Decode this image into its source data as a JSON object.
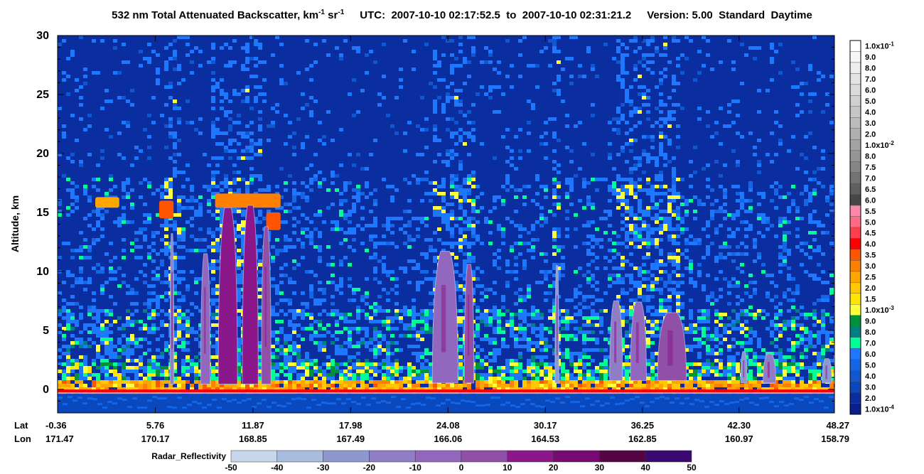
{
  "title": {
    "main": "532 nm Total Attenuated Backscatter, km",
    "sup1": "-1",
    "unit_mid": " sr",
    "sup2": "-1",
    "utc_label": "UTC:",
    "start_time": "2007-10-10 02:17:52.5",
    "to": "to",
    "end_time": "2007-10-10 02:31:21.2",
    "version": "Version: 5.00",
    "product": "Standard",
    "mode": "Daytime"
  },
  "chart_data": {
    "type": "heatmap",
    "ylabel": "Altitude, km",
    "ylim": [
      -2,
      30
    ],
    "yticks": [
      0,
      5,
      10,
      15,
      20,
      25,
      30
    ],
    "x_row_labels": [
      "Lat",
      "Lon"
    ],
    "lat": [
      "-0.36",
      "5.76",
      "11.87",
      "17.98",
      "24.08",
      "30.17",
      "36.25",
      "42.30",
      "48.27"
    ],
    "lon": [
      "171.47",
      "170.17",
      "168.85",
      "167.49",
      "166.06",
      "164.53",
      "162.85",
      "160.97",
      "158.79"
    ],
    "backscatter_colorbar": {
      "labels": [
        "1.0x10-1",
        "9.0",
        "8.0",
        "7.0",
        "6.0",
        "5.0",
        "4.0",
        "3.0",
        "2.0",
        "1.0x10-2",
        "8.0",
        "7.5",
        "7.0",
        "6.5",
        "6.0",
        "5.5",
        "5.0",
        "4.5",
        "4.0",
        "3.5",
        "3.0",
        "2.5",
        "2.0",
        "1.5",
        "1.0x10-3",
        "9.0",
        "8.0",
        "7.0",
        "6.0",
        "5.0",
        "4.0",
        "3.0",
        "2.0",
        "1.0x10-4"
      ],
      "colors": [
        "#ffffff",
        "#f6f6f6",
        "#ededed",
        "#e3e3e3",
        "#dadada",
        "#d0d0d0",
        "#c6c6c6",
        "#bcbcbc",
        "#b0b0b0",
        "#a3a3a3",
        "#959595",
        "#868686",
        "#737373",
        "#5f5f5f",
        "#474747",
        "#ff87a7",
        "#ff6b82",
        "#ff3d4e",
        "#ff0000",
        "#ff5500",
        "#ff7f00",
        "#ffa500",
        "#ffc800",
        "#ffe600",
        "#ffff3c",
        "#00913c",
        "#008080",
        "#00ff96",
        "#1e78ff",
        "#1466e6",
        "#0f58d2",
        "#0a48be",
        "#0a2da0",
        "#0a1e8c"
      ]
    },
    "radar_colorbar": {
      "title": "Radar_Reflectivity",
      "ticks": [
        "-50",
        "-40",
        "-30",
        "-20",
        "-10",
        "0",
        "10",
        "20",
        "30",
        "40",
        "50"
      ],
      "colors": [
        "#c8d6ea",
        "#a8bcde",
        "#8f97cf",
        "#8f7dc6",
        "#9168be",
        "#9150a8",
        "#8a188a",
        "#770a73",
        "#550544",
        "#3a0a70"
      ]
    },
    "plumes": [
      {
        "lat": 6.8,
        "base": 0.2,
        "top": 13.2,
        "half_width_lat": 0.12,
        "color": "#8f7dc6"
      },
      {
        "lat": 8.9,
        "base": 0.2,
        "top": 11.5,
        "half_width_lat": 0.3,
        "color": "#9168be"
      },
      {
        "lat": 10.3,
        "base": 0.2,
        "top": 15.4,
        "half_width_lat": 0.6,
        "color": "#8a188a"
      },
      {
        "lat": 11.7,
        "base": 0.2,
        "top": 15.6,
        "half_width_lat": 0.5,
        "color": "#8a188a"
      },
      {
        "lat": 12.7,
        "base": 0.2,
        "top": 13.8,
        "half_width_lat": 0.3,
        "color": "#9150a8"
      },
      {
        "lat": 23.9,
        "base": 0.3,
        "top": 11.7,
        "half_width_lat": 0.8,
        "color": "#9168be"
      },
      {
        "lat": 25.4,
        "base": 0.3,
        "top": 10.6,
        "half_width_lat": 0.3,
        "color": "#9150a8"
      },
      {
        "lat": 30.9,
        "base": 0.3,
        "top": 10.5,
        "half_width_lat": 0.12,
        "color": "#8f97cf"
      },
      {
        "lat": 34.6,
        "base": 0.5,
        "top": 7.5,
        "half_width_lat": 0.4,
        "color": "#8f7dc6"
      },
      {
        "lat": 36.0,
        "base": 0.5,
        "top": 7.4,
        "half_width_lat": 0.5,
        "color": "#9168be"
      },
      {
        "lat": 38.1,
        "base": 0.5,
        "top": 6.5,
        "half_width_lat": 0.9,
        "color": "#9150a8"
      },
      {
        "lat": 42.6,
        "base": 0.3,
        "top": 3.2,
        "half_width_lat": 0.2,
        "color": "#8f97cf"
      },
      {
        "lat": 44.2,
        "base": 0.3,
        "top": 3.0,
        "half_width_lat": 0.4,
        "color": "#8f7dc6"
      },
      {
        "lat": 47.8,
        "base": 0.3,
        "top": 2.6,
        "half_width_lat": 0.3,
        "color": "#8f97cf"
      }
    ],
    "high_clouds": [
      {
        "lat_start": 2.0,
        "lat_end": 3.5,
        "base": 15.4,
        "top": 16.3,
        "color": "#ffa500"
      },
      {
        "lat_start": 6.0,
        "lat_end": 6.9,
        "base": 14.5,
        "top": 16.0,
        "color": "#ff5500"
      },
      {
        "lat_start": 9.5,
        "lat_end": 13.6,
        "base": 15.4,
        "top": 16.6,
        "color": "#ff7f00"
      },
      {
        "lat_start": 12.7,
        "lat_end": 13.6,
        "base": 13.5,
        "top": 15.0,
        "color": "#ff5500"
      }
    ],
    "ground_km": -0.2
  }
}
